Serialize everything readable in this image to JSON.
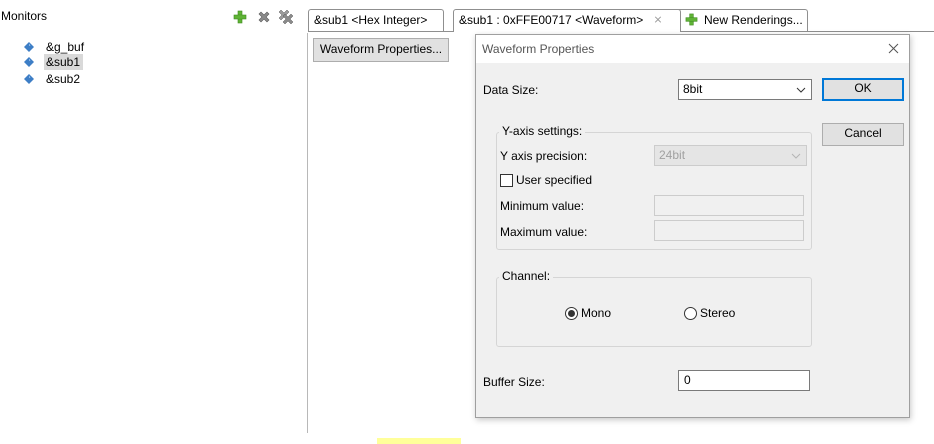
{
  "monitors": {
    "title": "Monitors",
    "items": [
      {
        "label": "&g_buf",
        "selected": false
      },
      {
        "label": "&sub1",
        "selected": true
      },
      {
        "label": "&sub2",
        "selected": false
      }
    ],
    "icons": {
      "add": "green-plus-icon",
      "remove": "gray-x-icon",
      "remove_all": "gray-double-x-icon",
      "item": "blue-diamond-icon"
    }
  },
  "tabs": [
    {
      "label": "&sub1 <Hex Integer>",
      "active": false
    },
    {
      "label": "&sub1 : 0xFFE00717 <Waveform>",
      "active": true,
      "close": "⨯"
    },
    {
      "label": "New Renderings...",
      "active": false
    }
  ],
  "editor": {
    "waveform_button": "Waveform Properties..."
  },
  "dialog": {
    "title": "Waveform Properties",
    "data_size_label": "Data Size:",
    "data_size_value": "8bit",
    "yaxis": {
      "legend": "Y-axis settings:",
      "precision_label": "Y axis precision:",
      "precision_value": "24bit",
      "user_specified_label": "User specified",
      "user_specified_checked": false,
      "min_label": "Minimum value:",
      "min_value": "",
      "max_label": "Maximum value:",
      "max_value": ""
    },
    "channel": {
      "legend": "Channel:",
      "mono_label": "Mono",
      "stereo_label": "Stereo",
      "selected": "Mono"
    },
    "buffer_size_label": "Buffer Size:",
    "buffer_size_value": "0",
    "ok_label": "OK",
    "cancel_label": "Cancel"
  },
  "colors": {
    "accent": "#0078d7",
    "dialog_bg": "#f0f0f0",
    "selection": "#d9d9d9",
    "plus_green": "#5fb336",
    "diamond_blue": "#3d7ec6"
  }
}
